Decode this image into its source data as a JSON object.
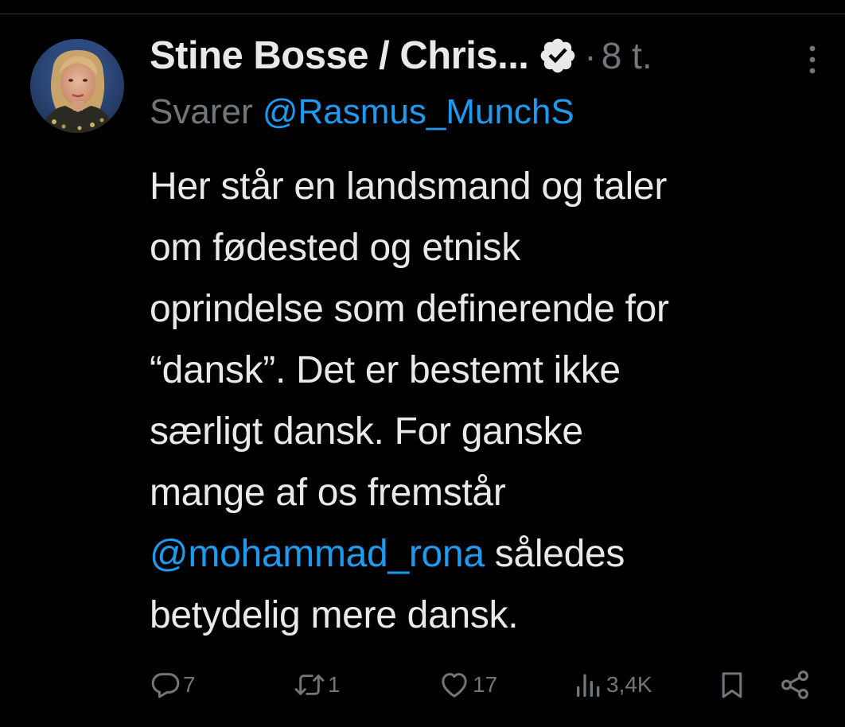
{
  "tweet": {
    "author": {
      "display_name": "Stine Bosse / Chris...",
      "verified_icon": "verified-badge-icon",
      "avatar": "author-avatar"
    },
    "separator": "·",
    "timestamp": "8 t.",
    "reply_prefix": "Svarer",
    "reply_to": "@Rasmus_MunchS",
    "text_lines": [
      {
        "text": "Her står en landsmand og taler"
      },
      {
        "text": "om fødested og etnisk"
      },
      {
        "text": "oprindelse som definerende for"
      },
      {
        "text": "“dansk”. Det er bestemt ikke"
      },
      {
        "text": "særligt dansk. For ganske"
      },
      {
        "text": "mange af os fremstår"
      },
      {
        "mention": "@mohammad_rona",
        "text": " således"
      },
      {
        "text": "betydelig mere dansk."
      }
    ],
    "actions": {
      "replies": "7",
      "reposts": "1",
      "likes": "17",
      "views": "3,4K"
    }
  },
  "colors": {
    "background": "#000000",
    "text": "#e7e9ea",
    "muted": "#71767b",
    "link": "#1d9bf0",
    "divider": "#2f3336"
  }
}
